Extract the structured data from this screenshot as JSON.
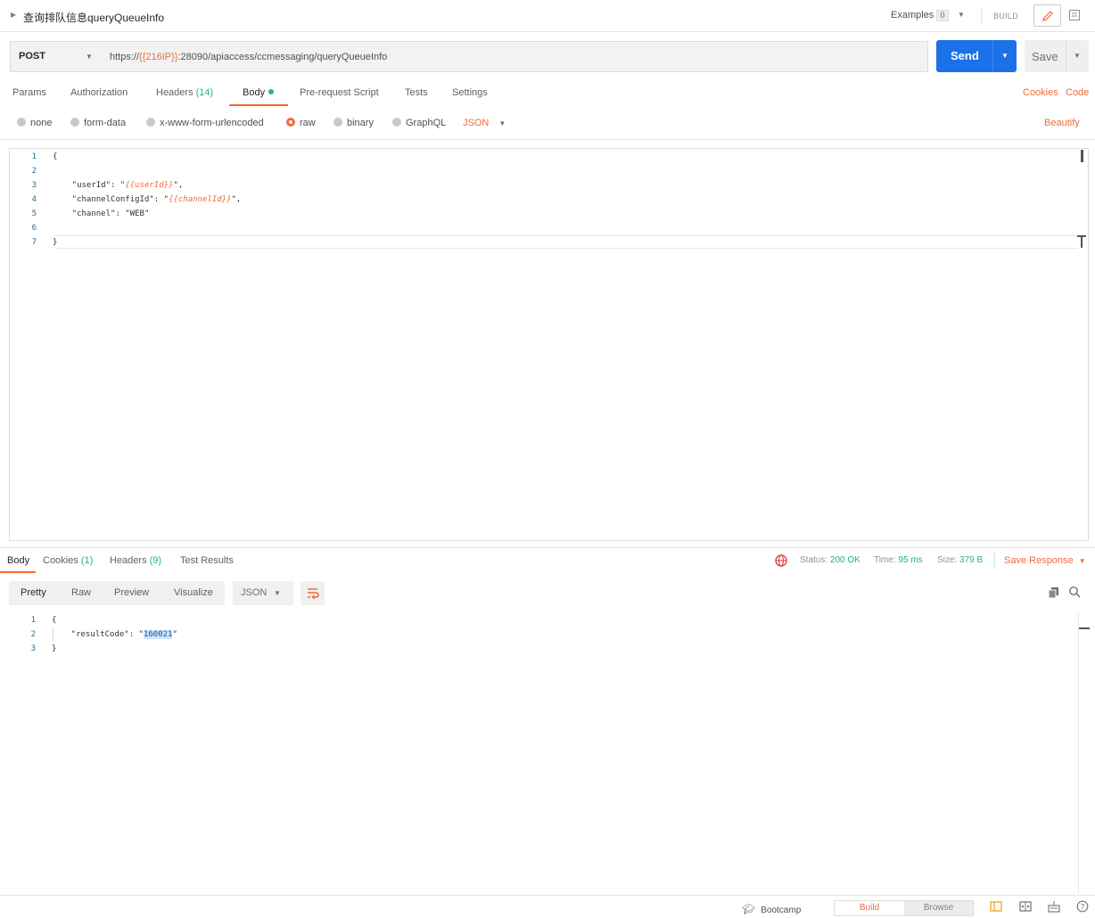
{
  "titlebar": {
    "title": "查询排队信息queryQueueInfo",
    "caret": "▶",
    "examples_label": "Examples",
    "examples_count": "0",
    "build_label": "BUILD"
  },
  "request": {
    "method": "POST",
    "url_prefix": "https://",
    "url_var": "{{216IP}}",
    "url_suffix": ":28090/apiaccess/ccmessaging/queryQueueInfo",
    "send_label": "Send",
    "save_label": "Save"
  },
  "tabs": {
    "params": "Params",
    "authorization": "Authorization",
    "headers": "Headers",
    "headers_count": "(14)",
    "body": "Body",
    "prerequest": "Pre-request Script",
    "tests": "Tests",
    "settings": "Settings",
    "cookies": "Cookies",
    "code": "Code"
  },
  "body_types": {
    "none": "none",
    "form_data": "form-data",
    "urlencoded": "x-www-form-urlencoded",
    "raw": "raw",
    "binary": "binary",
    "graphql": "GraphQL",
    "selected_format": "JSON",
    "beautify": "Beautify"
  },
  "editor": {
    "line_numbers": [
      "1",
      "2",
      "3",
      "4",
      "5",
      "6",
      "7"
    ],
    "lines": [
      {
        "pre": "{",
        "var": "",
        "post": ""
      },
      {
        "pre": "",
        "var": "",
        "post": ""
      },
      {
        "pre": "    \"userId\": \"",
        "var": "{{userId}}",
        "post": "\","
      },
      {
        "pre": "    \"channelConfigId\": \"",
        "var": "{{channelId}}",
        "post": "\","
      },
      {
        "pre": "    \"channel\": \"WEB\"",
        "var": "",
        "post": ""
      },
      {
        "pre": "",
        "var": "",
        "post": ""
      },
      {
        "pre": "}",
        "var": "",
        "post": ""
      }
    ]
  },
  "response": {
    "tabs": {
      "body": "Body",
      "cookies": "Cookies",
      "cookies_count": "(1)",
      "headers": "Headers",
      "headers_count": "(9)",
      "test_results": "Test Results"
    },
    "status_label": "Status:",
    "status_value": "200 OK",
    "time_label": "Time:",
    "time_value": "95 ms",
    "size_label": "Size:",
    "size_value": "379 B",
    "save_response": "Save Response",
    "views": {
      "pretty": "Pretty",
      "raw": "Raw",
      "preview": "Preview",
      "visualize": "Visualize"
    },
    "format": "JSON",
    "line_numbers": [
      "1",
      "2",
      "3"
    ],
    "line1": "{",
    "line2_key": "    \"resultCode\": \"",
    "line2_value": "160021",
    "line2_end": "\"",
    "line3": "}"
  },
  "footer": {
    "bootcamp": "Bootcamp",
    "build": "Build",
    "browse": "Browse"
  },
  "colors": {
    "accent": "#f26b3a",
    "send": "#1b72e8",
    "success": "#26b47f"
  }
}
